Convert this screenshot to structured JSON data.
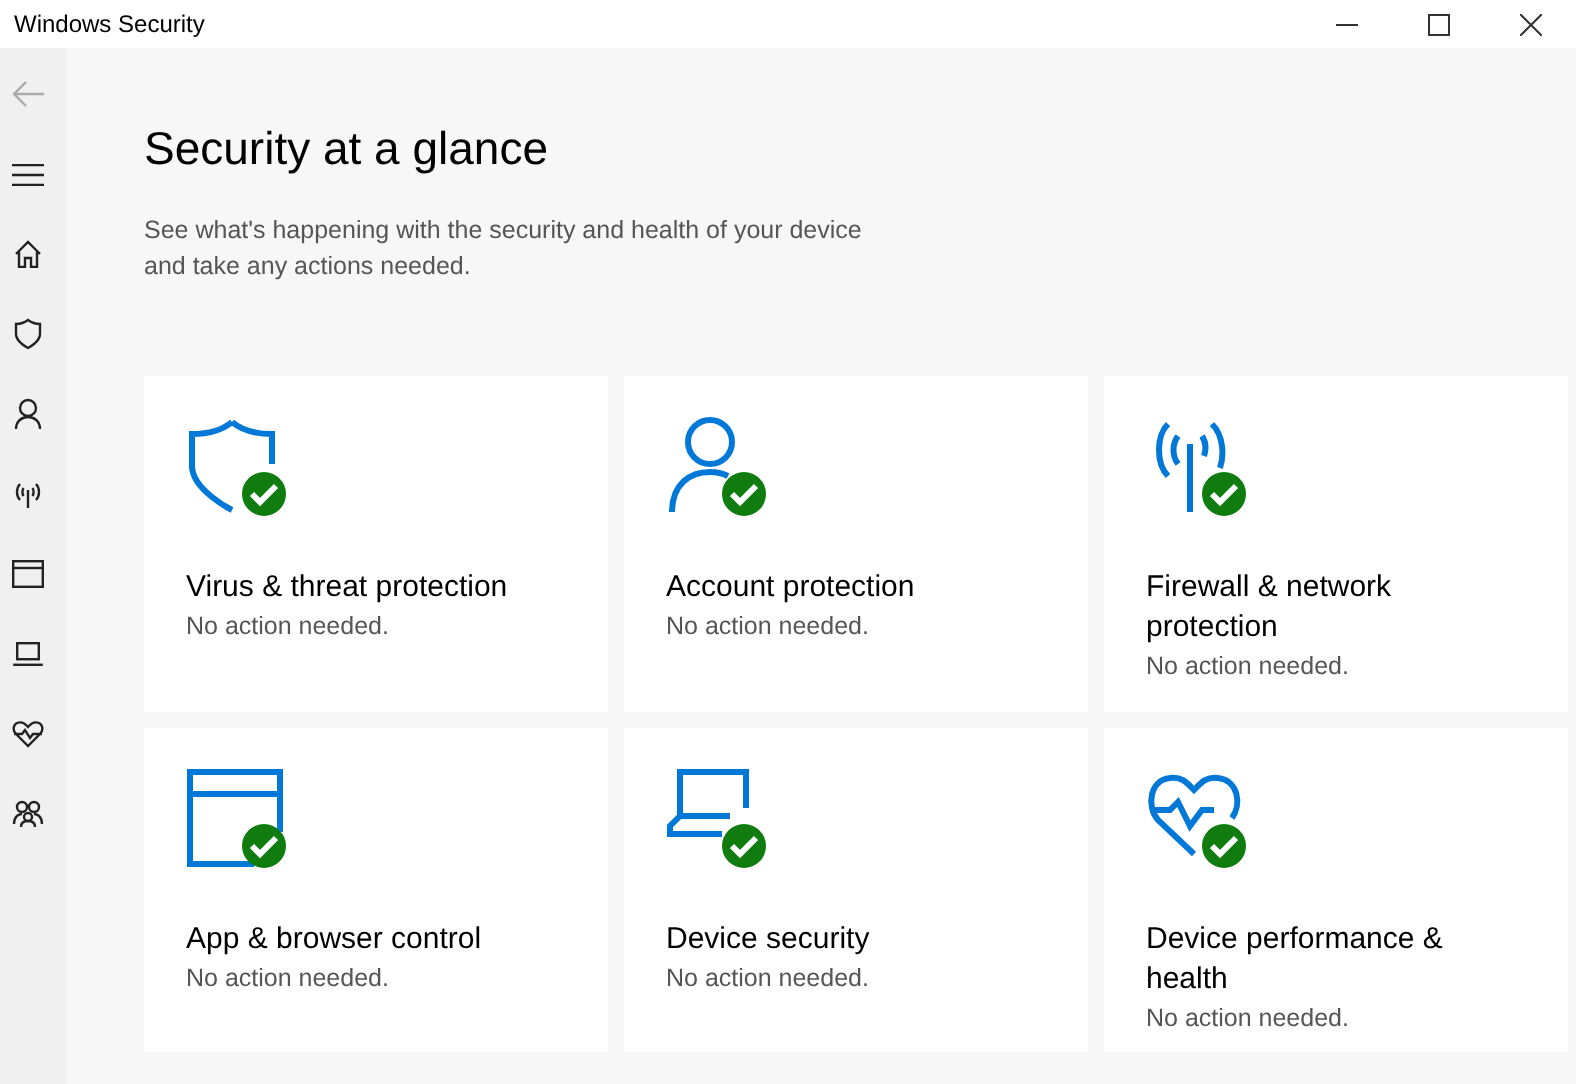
{
  "window": {
    "title": "Windows Security"
  },
  "sidebar": {
    "items": [
      {
        "kind": "back",
        "disabled": true
      },
      {
        "kind": "menu",
        "disabled": false
      },
      {
        "kind": "home",
        "disabled": false
      },
      {
        "kind": "shield",
        "disabled": false
      },
      {
        "kind": "person",
        "disabled": false
      },
      {
        "kind": "signal",
        "disabled": false
      },
      {
        "kind": "browser",
        "disabled": false
      },
      {
        "kind": "laptop",
        "disabled": false
      },
      {
        "kind": "heart",
        "disabled": false
      },
      {
        "kind": "family",
        "disabled": false
      }
    ]
  },
  "heading": "Security at a glance",
  "subtitle": "See what's happening with the security and health of your device and take any actions needed.",
  "cards": [
    {
      "kind": "shield",
      "title": "Virus & threat protection",
      "status_text": "No action needed.",
      "ok": true
    },
    {
      "kind": "person",
      "title": "Account protection",
      "status_text": "No action needed.",
      "ok": true
    },
    {
      "kind": "signal",
      "title": "Firewall & network protection",
      "status_text": "No action needed.",
      "ok": true
    },
    {
      "kind": "browser",
      "title": "App & browser control",
      "status_text": "No action needed.",
      "ok": true
    },
    {
      "kind": "laptop",
      "title": "Device security",
      "status_text": "No action needed.",
      "ok": true
    },
    {
      "kind": "heart",
      "title": "Device performance & health",
      "status_text": "No action needed.",
      "ok": true
    }
  ]
}
